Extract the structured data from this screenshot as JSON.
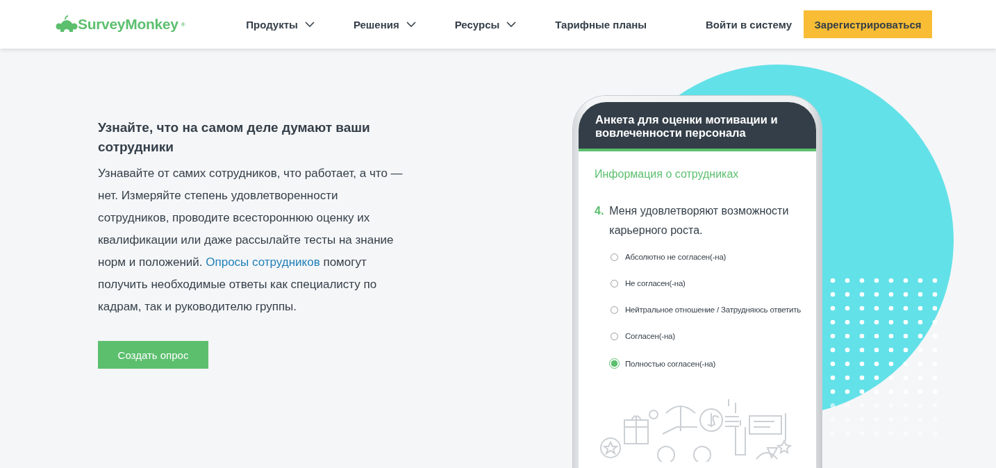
{
  "header": {
    "logo": "SurveyMonkey$^{®}$",
    "nav": [
      {
        "label": "Продукты",
        "dropdown": true
      },
      {
        "label": "Решения",
        "dropdown": true
      },
      {
        "label": "Ресурсы",
        "dropdown": true
      },
      {
        "label": "Тарифные планы",
        "dropdown": false
      }
    ],
    "login": "Войти в систему",
    "signup": "Зарегистрироваться"
  },
  "hero": {
    "heading": "Узнайте, что на самом деле думают ваши сотрудники",
    "body_before": "Узнавайте от самих сотрудников, что работает, а что — нет. Измеряйте степень удовлетворенности сотрудников, проводите всестороннюю оценку их квалификации или даже рассылайте тесты на знание норм и положений.",
    "body_link": "Опросы сотрудников",
    "body_after": "помогут получить необходимые ответы как специалисту по кадрам, так и руководителю группы.",
    "button": "Создать опрос"
  },
  "survey": {
    "title": "Анкета для оценки мотивации и вовлеченности персонала",
    "section": "Информация о сотрудниках",
    "question_number": "4.",
    "question": "Меня удовлетворяют возможности карьерного роста.",
    "options": [
      {
        "label": "Абсолютно не согласен(-на)",
        "selected": false
      },
      {
        "label": "Не согласен(-на)",
        "selected": false
      },
      {
        "label": "Нейтральное отношение / Затрудняюсь ответить",
        "selected": false
      },
      {
        "label": "Согласен(-на)",
        "selected": false
      },
      {
        "label": "Полностью согласен(-на)",
        "selected": true
      }
    ]
  }
}
